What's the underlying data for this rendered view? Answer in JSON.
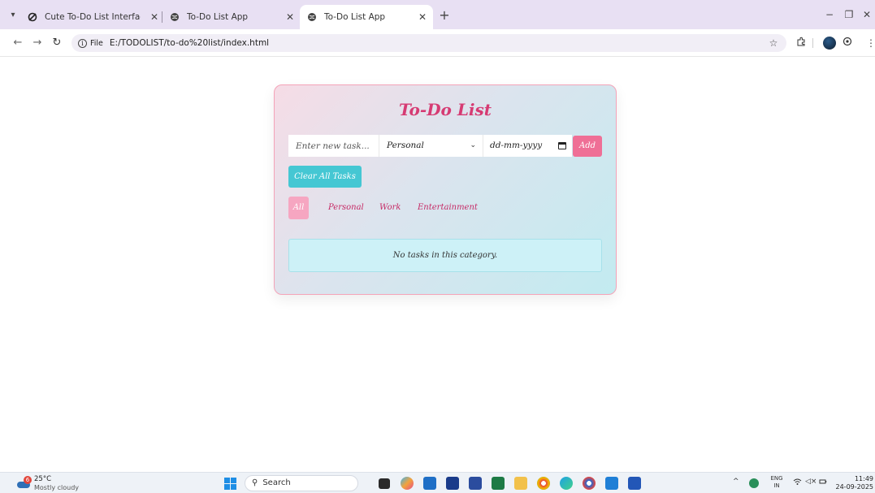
{
  "browser": {
    "tabs": [
      {
        "title": "Cute To-Do List Interface Desig",
        "active": false
      },
      {
        "title": "To-Do List App",
        "active": false
      },
      {
        "title": "To-Do List App",
        "active": true
      }
    ],
    "new_tab_label": "+",
    "window_controls": {
      "minimize": "−",
      "restore": "❐",
      "close": "✕"
    },
    "address": {
      "scheme_chip": "File",
      "url": "E:/TODOLIST/to-do%20list/index.html"
    }
  },
  "app": {
    "title": "To-Do List",
    "task_input_placeholder": "Enter new task...",
    "category_selected": "Personal",
    "date_placeholder": "dd-mm-yyyy",
    "add_label": "Add",
    "clear_label": "Clear All Tasks",
    "filters": [
      "All",
      "Personal",
      "Work",
      "Entertainment"
    ],
    "active_filter": "All",
    "empty_message": "No tasks in this category."
  },
  "taskbar": {
    "weather": {
      "badge": "6",
      "temp": "25°C",
      "desc": "Mostly cloudy"
    },
    "search_label": "Search",
    "language": {
      "line1": "ENG",
      "line2": "IN"
    },
    "time": "11:49",
    "date": "24-09-2025"
  },
  "colors": {
    "accent_pink": "#ef6f96",
    "title_pink": "#d63b73",
    "teal_button": "#45c7d3",
    "active_filter_bg": "#f6a6c1",
    "empty_box_bg": "#cdf1f7"
  }
}
